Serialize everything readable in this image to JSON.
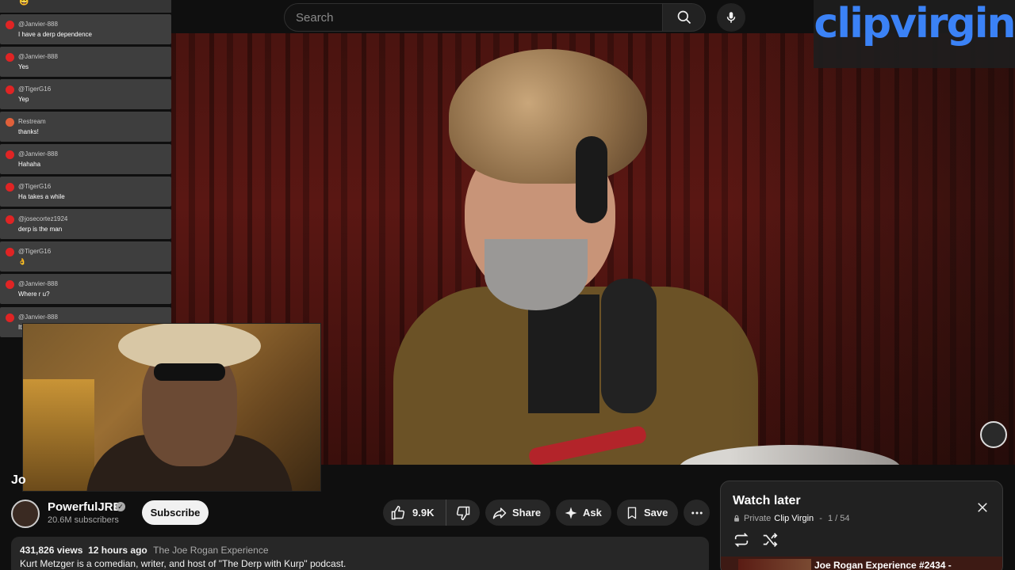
{
  "search": {
    "placeholder": "Search"
  },
  "watermark": {
    "text": "clipvirgin"
  },
  "chat": {
    "top_emoji": "😄",
    "messages": [
      {
        "user": "@Janvier-888",
        "text": "I have a derp dependence"
      },
      {
        "user": "@Janvier-888",
        "text": "Yes"
      },
      {
        "user": "@TigerG16",
        "text": "Yep"
      },
      {
        "user": "Restream",
        "text": "thanks!"
      },
      {
        "user": "@Janvier-888",
        "text": "Hahaha"
      },
      {
        "user": "@TigerG16",
        "text": "Ha takes a while"
      },
      {
        "user": "@josecortez1924",
        "text": "derp is the man"
      },
      {
        "user": "@TigerG16",
        "text": "👌"
      },
      {
        "user": "@Janvier-888",
        "text": "Where r u?"
      },
      {
        "user": "@Janvier-888",
        "text": "It"
      }
    ]
  },
  "video": {
    "title_partial": "Jo"
  },
  "channel": {
    "name": "PowerfulJRE",
    "subscribers": "20.6M subscribers",
    "subscribe_label": "Subscribe"
  },
  "actions": {
    "likes": "9.9K",
    "share": "Share",
    "ask": "Ask",
    "save": "Save"
  },
  "description": {
    "views": "431,826 views",
    "age": "12 hours ago",
    "tag": "The Joe Rogan Experience",
    "text": "Kurt Metzger is a comedian, writer, and host of \"The Derp with Kurp\" podcast."
  },
  "playlist": {
    "title": "Watch later",
    "privacy": "Private",
    "owner": "Clip Virgin",
    "position": "1 / 54",
    "first_item_title": "Joe Rogan Experience #2434 -"
  },
  "colors": {
    "accent": "#3b82f6",
    "background": "#0f0f0f",
    "chip": "#272727"
  }
}
